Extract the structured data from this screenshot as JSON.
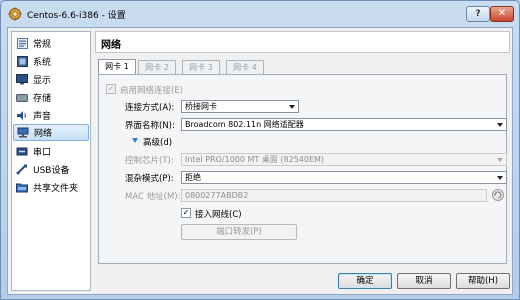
{
  "window": {
    "title": "Centos-6.6-i386 - 设置",
    "help_glyph": "?",
    "close_glyph": "✕"
  },
  "sidebar": {
    "items": [
      {
        "label": "常规",
        "icon": "general-icon"
      },
      {
        "label": "系统",
        "icon": "system-icon"
      },
      {
        "label": "显示",
        "icon": "display-icon"
      },
      {
        "label": "存储",
        "icon": "storage-icon"
      },
      {
        "label": "声音",
        "icon": "audio-icon"
      },
      {
        "label": "网络",
        "icon": "network-icon",
        "selected": true
      },
      {
        "label": "串口",
        "icon": "serial-port-icon"
      },
      {
        "label": "USB设备",
        "icon": "usb-icon"
      },
      {
        "label": "共享文件夹",
        "icon": "shared-folder-icon"
      }
    ]
  },
  "panel": {
    "title": "网络",
    "tabs": [
      {
        "label": "网卡 1",
        "active": true
      },
      {
        "label": "网卡 2",
        "active": false
      },
      {
        "label": "网卡 3",
        "active": false
      },
      {
        "label": "网卡 4",
        "active": false
      }
    ],
    "enable_adapter": {
      "label": "启用网络连接(E)",
      "checked": true
    },
    "attached_to": {
      "label": "连接方式(A):",
      "value": "桥接网卡"
    },
    "interface_name": {
      "label": "界面名称(N):",
      "value": "Broadcom 802.11n 网络适配器"
    },
    "advanced": {
      "label": "高级(d)"
    },
    "adapter_type": {
      "label": "控制芯片(T):",
      "value": "Intel PRO/1000 MT 桌面 (82540EM)"
    },
    "promiscuous": {
      "label": "混杂模式(P):",
      "value": "拒绝"
    },
    "mac": {
      "label": "MAC 地址(M):",
      "value": "0800277ABDB2"
    },
    "cable": {
      "label": "接入网线(C)",
      "checked": true
    },
    "port_forward": {
      "label": "端口转发(P)"
    }
  },
  "footer": {
    "ok": "确定",
    "cancel": "取消",
    "help": "帮助(H)"
  }
}
